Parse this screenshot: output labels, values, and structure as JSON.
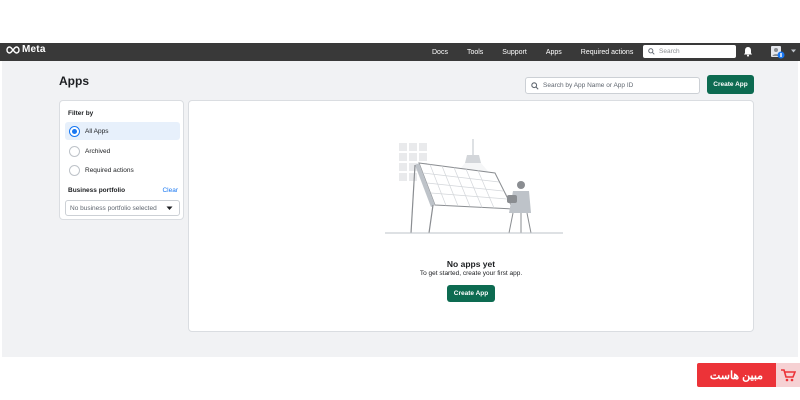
{
  "brand": {
    "name": "Meta"
  },
  "nav": {
    "items": [
      {
        "label": "Docs"
      },
      {
        "label": "Tools"
      },
      {
        "label": "Support"
      },
      {
        "label": "Apps"
      },
      {
        "label": "Required actions"
      }
    ],
    "search_placeholder": "Search"
  },
  "page": {
    "title": "Apps",
    "search_placeholder": "Search by App Name or App ID",
    "create_label": "Create App"
  },
  "filter": {
    "title": "Filter by",
    "options": [
      {
        "label": "All Apps",
        "selected": true
      },
      {
        "label": "Archived",
        "selected": false
      },
      {
        "label": "Required actions",
        "selected": false
      }
    ],
    "portfolio_label": "Business portfolio",
    "clear_label": "Clear",
    "portfolio_value": "No business portfolio selected"
  },
  "empty_state": {
    "title": "No apps yet",
    "subtitle": "To get started, create your first app.",
    "button_label": "Create App"
  },
  "watermark": {
    "text": "مبین هاست"
  },
  "colors": {
    "topbar": "#393939",
    "primary_button": "#0d6b51",
    "selected_bg": "#e7f0fb",
    "radio_accent": "#1877f2",
    "link": "#1877f2",
    "page_bg": "#f1f2f4",
    "badge": "#ec3338"
  },
  "icons": {
    "logo": "meta-infinity-icon",
    "search": "search-icon",
    "bell": "bell-icon",
    "avatar": "avatar-icon",
    "caret": "chevron-down-icon"
  }
}
